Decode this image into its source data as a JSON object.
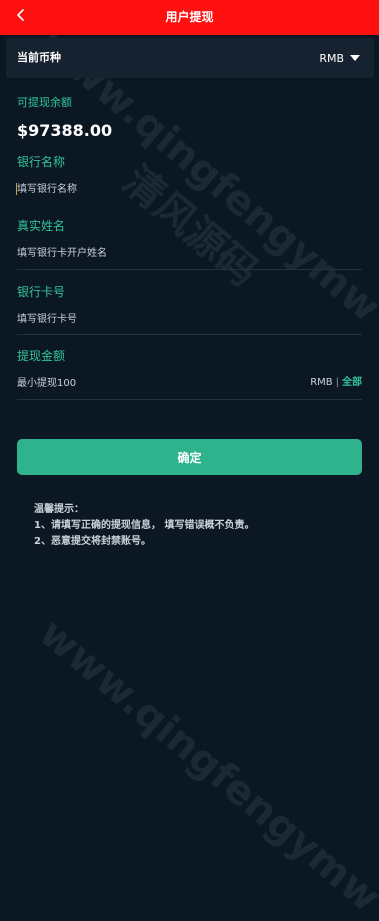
{
  "header": {
    "title": "用户提现",
    "back_icon": "chevron-left-icon",
    "background_color": "#ff1010"
  },
  "currency": {
    "label": "当前币种",
    "value": "RMB",
    "dropdown_icon": "caret-down-icon"
  },
  "balance": {
    "label": "可提现余额",
    "value": "$97388.00"
  },
  "fields": {
    "bank_name": {
      "label": "银行名称",
      "placeholder": "填写银行名称"
    },
    "real_name": {
      "label": "真实姓名",
      "placeholder": "填写银行卡开户姓名"
    },
    "card_number": {
      "label": "银行卡号",
      "placeholder": "填写银行卡号"
    },
    "amount": {
      "label": "提现金额",
      "placeholder": "最小提现100",
      "unit": "RMB",
      "separator": "|",
      "all_label": "全部"
    }
  },
  "confirm_button": {
    "label": "确定",
    "color": "#2fb38d"
  },
  "tips": {
    "title": "温馨提示：",
    "lines": [
      "1、请填写正确的提现信息， 填写错误概不负责。",
      "2、恶意提交将封禁账号。"
    ]
  },
  "watermark": {
    "domain": "www.qingfengymw",
    "name": "清风源码"
  },
  "accent_color": "#33c39a",
  "background_color": "#0b1824"
}
